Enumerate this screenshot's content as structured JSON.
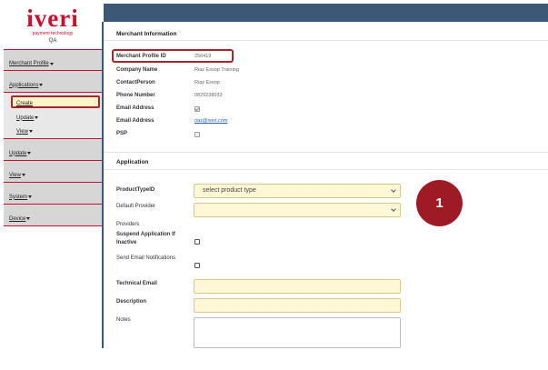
{
  "brand": {
    "logo_text": "iveri",
    "tagline": "payment technology",
    "environment": "QA",
    "accent_color": "#c8102e",
    "topbar_color": "#3d5777"
  },
  "sidebar": {
    "items": [
      {
        "label": "Merchant Profile"
      },
      {
        "label": "Applications"
      },
      {
        "label": "Update"
      },
      {
        "label": "View"
      },
      {
        "label": "System"
      },
      {
        "label": "Device"
      }
    ],
    "applications_sub": [
      {
        "label": "Create",
        "active": true
      },
      {
        "label": "Update"
      },
      {
        "label": "View"
      }
    ]
  },
  "merchant": {
    "section_title": "Merchant Information",
    "profile_id_label": "Merchant Profile ID",
    "profile_id_value": "256419",
    "company_label": "Company Name",
    "company_value": "Riaz Essop Training",
    "contact_label": "ContactPerson",
    "contact_value": "Riaz Essop",
    "phone_label": "Phone Number",
    "phone_value": "0829238033",
    "email1_label": "Email Address",
    "email2_label": "Email Address",
    "email2_value": "riaz@iveri.com",
    "psp_label": "PSP"
  },
  "application": {
    "section_title": "Application",
    "product_type_label": "ProductTypeID",
    "product_type_placeholder": "select product type",
    "default_provider_label": "Default Provider",
    "providers_label": "Providers",
    "suspend_label_line1": "Suspend Application If",
    "suspend_label_line2": "Inactive",
    "send_email_label": "Send Email Notifications",
    "technical_email_label": "Technical Email",
    "description_label": "Description",
    "notes_label": "Notes"
  },
  "callout": {
    "number": "1",
    "color": "#9e1b26"
  }
}
